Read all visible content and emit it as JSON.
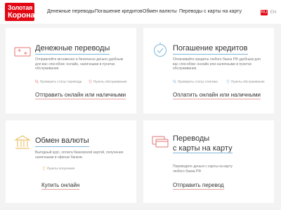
{
  "header": {
    "logo_line1": "Золотая",
    "logo_line2": "Корона",
    "nav": [
      "Денежные переводы",
      "Погашение кредитов",
      "Обмен валюты",
      "Переводы с карты на карту"
    ],
    "lang_active": "RU",
    "lang_inactive": "EN"
  },
  "cards": [
    {
      "title": "Денежные переводы",
      "desc": "Отправляйте мгновенно и безопасно деньги удобным для вас способом: онлайн, наличными в пунктах обслуживания.",
      "meta1": "Проверить статус перевода",
      "meta2": "Пункты обслуживания",
      "action": "Отправить онлайн или наличными"
    },
    {
      "title": "Погашение кредитов",
      "desc": "Оплачивайте кредиты любого банка РФ удобным для вас способом: онлайн или наличными в пунктах обслуживания.",
      "meta1": "Проверить статус платежа",
      "meta2": "Пункты обслуживания",
      "action": "Оплатить онлайн или наличными"
    },
    {
      "title": "Обмен валюты",
      "desc": "Выгодный курс, оплата банковской картой, получение наличными в офисах банков.",
      "meta1": "Пункты получения",
      "action": "Купить онлайн"
    },
    {
      "title_line1": "Переводы",
      "title_line2": "с карты на карту",
      "desc": "Переводите деньги с карты на карту любого банка РФ",
      "action": "Отправить перевод"
    }
  ],
  "colors": {
    "brand_red": "#e30613",
    "icon_red": "#e57373",
    "icon_blue": "#7eb6d9",
    "icon_yellow": "#e8b64c"
  },
  "icons": [
    "money-transfer-icon",
    "credit-repayment-icon",
    "currency-exchange-icon",
    "card-to-card-icon",
    "search-icon",
    "location-pin-icon"
  ]
}
